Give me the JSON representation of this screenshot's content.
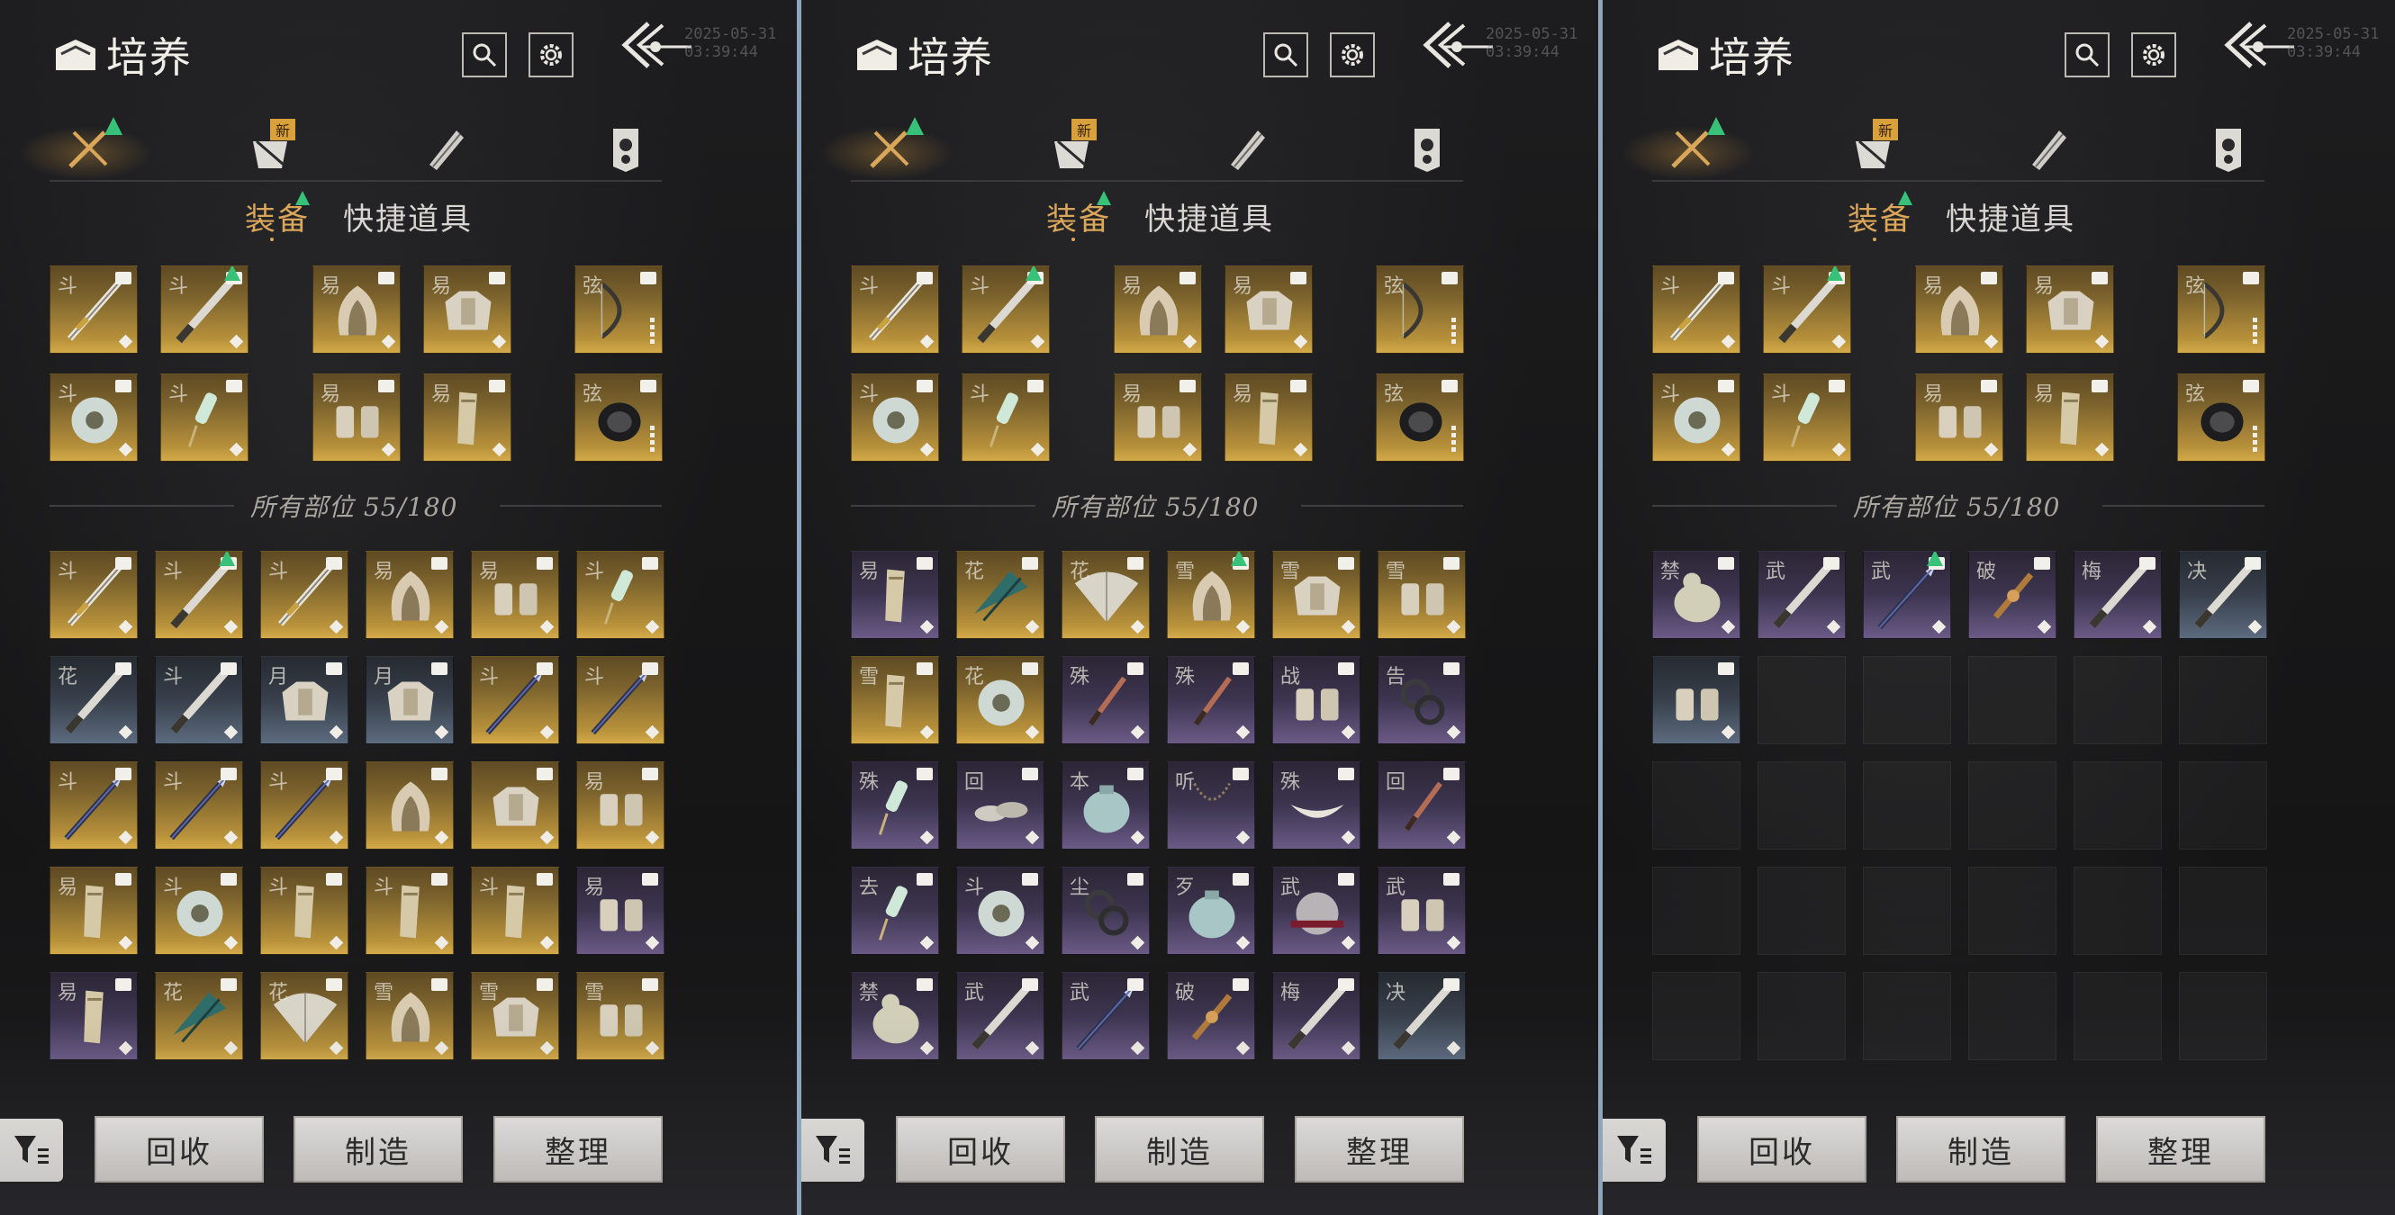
{
  "panels": [
    {
      "header": {
        "title": "培养",
        "timestamp": "2025-05-31 03:39:44"
      },
      "tabs": {
        "equip": "装备",
        "quick": "快捷道具",
        "new_badge": "新"
      },
      "total": "所有部位 55/180",
      "equipped": [
        {
          "char": "斗",
          "q": "gold",
          "art": "sword"
        },
        {
          "char": "斗",
          "q": "gold",
          "art": "blade",
          "up": true
        },
        {
          "char": "易",
          "q": "gold",
          "art": "hood"
        },
        {
          "char": "易",
          "q": "gold",
          "art": "armor"
        },
        {
          "char": "弦",
          "q": "gold",
          "art": "bow",
          "pips": true
        },
        {
          "char": "斗",
          "q": "gold",
          "art": "disc"
        },
        {
          "char": "斗",
          "q": "gold",
          "art": "pendant"
        },
        {
          "char": "易",
          "q": "gold",
          "art": "gloves"
        },
        {
          "char": "易",
          "q": "gold",
          "art": "leg"
        },
        {
          "char": "弦",
          "q": "gold",
          "art": "quiver",
          "pips": true
        }
      ],
      "inventory": [
        {
          "char": "斗",
          "q": "gold",
          "art": "sword"
        },
        {
          "char": "斗",
          "q": "gold",
          "art": "blade",
          "up": true
        },
        {
          "char": "斗",
          "q": "gold",
          "art": "sword"
        },
        {
          "char": "易",
          "q": "gold",
          "art": "hood"
        },
        {
          "char": "易",
          "q": "gold",
          "art": "gloves"
        },
        {
          "char": "斗",
          "q": "gold",
          "art": "pendant"
        },
        {
          "char": "花",
          "q": "blue",
          "art": "blade"
        },
        {
          "char": "斗",
          "q": "blue",
          "art": "blade"
        },
        {
          "char": "月",
          "q": "blue",
          "art": "armor"
        },
        {
          "char": "月",
          "q": "blue",
          "art": "armor"
        },
        {
          "char": "斗",
          "q": "gold",
          "art": "spear"
        },
        {
          "char": "斗",
          "q": "gold",
          "art": "spear"
        },
        {
          "char": "斗",
          "q": "gold",
          "art": "spear"
        },
        {
          "char": "斗",
          "q": "gold",
          "art": "spear"
        },
        {
          "char": "斗",
          "q": "gold",
          "art": "spear"
        },
        {
          "char": "",
          "q": "gold",
          "art": "hood"
        },
        {
          "char": "",
          "q": "gold",
          "art": "armor"
        },
        {
          "char": "易",
          "q": "gold",
          "art": "gloves"
        },
        {
          "char": "易",
          "q": "gold",
          "art": "leg"
        },
        {
          "char": "斗",
          "q": "gold",
          "art": "disc"
        },
        {
          "char": "斗",
          "q": "gold",
          "art": "leg"
        },
        {
          "char": "斗",
          "q": "gold",
          "art": "leg"
        },
        {
          "char": "斗",
          "q": "gold",
          "art": "leg"
        },
        {
          "char": "易",
          "q": "purple",
          "art": "gloves"
        },
        {
          "char": "易",
          "q": "purple",
          "art": "leg"
        },
        {
          "char": "花",
          "q": "gold",
          "art": "umbrella"
        },
        {
          "char": "花",
          "q": "gold",
          "art": "fan"
        },
        {
          "char": "雪",
          "q": "gold",
          "art": "hood"
        },
        {
          "char": "雪",
          "q": "gold",
          "art": "armor"
        },
        {
          "char": "雪",
          "q": "gold",
          "art": "gloves"
        }
      ]
    },
    {
      "header": {
        "title": "培养",
        "timestamp": "2025-05-31 03:39:44"
      },
      "tabs": {
        "equip": "装备",
        "quick": "快捷道具",
        "new_badge": "新"
      },
      "total": "所有部位 55/180",
      "equipped": [
        {
          "char": "斗",
          "q": "gold",
          "art": "sword"
        },
        {
          "char": "斗",
          "q": "gold",
          "art": "blade",
          "up": true
        },
        {
          "char": "易",
          "q": "gold",
          "art": "hood"
        },
        {
          "char": "易",
          "q": "gold",
          "art": "armor"
        },
        {
          "char": "弦",
          "q": "gold",
          "art": "bow",
          "pips": true
        },
        {
          "char": "斗",
          "q": "gold",
          "art": "disc"
        },
        {
          "char": "斗",
          "q": "gold",
          "art": "pendant"
        },
        {
          "char": "易",
          "q": "gold",
          "art": "gloves"
        },
        {
          "char": "易",
          "q": "gold",
          "art": "leg"
        },
        {
          "char": "弦",
          "q": "gold",
          "art": "quiver",
          "pips": true
        }
      ],
      "inventory": [
        {
          "char": "易",
          "q": "purple",
          "art": "leg"
        },
        {
          "char": "花",
          "q": "gold",
          "art": "umbrella"
        },
        {
          "char": "花",
          "q": "gold",
          "art": "fan"
        },
        {
          "char": "雪",
          "q": "gold",
          "art": "hood",
          "up": true
        },
        {
          "char": "雪",
          "q": "gold",
          "art": "armor"
        },
        {
          "char": "雪",
          "q": "gold",
          "art": "gloves"
        },
        {
          "char": "雪",
          "q": "gold",
          "art": "leg"
        },
        {
          "char": "花",
          "q": "gold",
          "art": "disc"
        },
        {
          "char": "殊",
          "q": "purple",
          "art": "dagger"
        },
        {
          "char": "殊",
          "q": "purple",
          "art": "dagger"
        },
        {
          "char": "战",
          "q": "purple",
          "art": "gloves"
        },
        {
          "char": "告",
          "q": "purple",
          "art": "ring"
        },
        {
          "char": "殊",
          "q": "purple",
          "art": "pendant"
        },
        {
          "char": "回",
          "q": "purple",
          "art": "shoes"
        },
        {
          "char": "本",
          "q": "purple",
          "art": "pouch"
        },
        {
          "char": "听",
          "q": "purple",
          "art": "chain"
        },
        {
          "char": "殊",
          "q": "purple",
          "art": "crescent"
        },
        {
          "char": "回",
          "q": "purple",
          "art": "dagger"
        },
        {
          "char": "去",
          "q": "purple",
          "art": "pendant"
        },
        {
          "char": "斗",
          "q": "purple",
          "art": "disc"
        },
        {
          "char": "尘",
          "q": "purple",
          "art": "ring"
        },
        {
          "char": "歹",
          "q": "purple",
          "art": "pouch"
        },
        {
          "char": "武",
          "q": "purple",
          "art": "orb"
        },
        {
          "char": "武",
          "q": "purple",
          "art": "gloves"
        },
        {
          "char": "禁",
          "q": "purple",
          "art": "creature"
        },
        {
          "char": "武",
          "q": "purple",
          "art": "blade"
        },
        {
          "char": "武",
          "q": "purple",
          "art": "spear"
        },
        {
          "char": "破",
          "q": "purple",
          "art": "vajra"
        },
        {
          "char": "梅",
          "q": "purple",
          "art": "blade"
        },
        {
          "char": "决",
          "q": "blue",
          "art": "blade"
        }
      ]
    },
    {
      "header": {
        "title": "培养",
        "timestamp": "2025-05-31 03:39:44"
      },
      "tabs": {
        "equip": "装备",
        "quick": "快捷道具",
        "new_badge": "新"
      },
      "total": "所有部位 55/180",
      "equipped": [
        {
          "char": "斗",
          "q": "gold",
          "art": "sword"
        },
        {
          "char": "斗",
          "q": "gold",
          "art": "blade",
          "up": true
        },
        {
          "char": "易",
          "q": "gold",
          "art": "hood"
        },
        {
          "char": "易",
          "q": "gold",
          "art": "armor"
        },
        {
          "char": "弦",
          "q": "gold",
          "art": "bow",
          "pips": true
        },
        {
          "char": "斗",
          "q": "gold",
          "art": "disc"
        },
        {
          "char": "斗",
          "q": "gold",
          "art": "pendant"
        },
        {
          "char": "易",
          "q": "gold",
          "art": "gloves"
        },
        {
          "char": "易",
          "q": "gold",
          "art": "leg"
        },
        {
          "char": "弦",
          "q": "gold",
          "art": "quiver",
          "pips": true
        }
      ],
      "inventory": [
        {
          "char": "禁",
          "q": "purple",
          "art": "creature"
        },
        {
          "char": "武",
          "q": "purple",
          "art": "blade"
        },
        {
          "char": "武",
          "q": "purple",
          "art": "spear",
          "up": true
        },
        {
          "char": "破",
          "q": "purple",
          "art": "vajra"
        },
        {
          "char": "梅",
          "q": "purple",
          "art": "blade"
        },
        {
          "char": "决",
          "q": "blue",
          "art": "blade"
        },
        {
          "char": "",
          "q": "blue",
          "art": "gloves"
        },
        {
          "q": "empty"
        },
        {
          "q": "empty"
        },
        {
          "q": "empty"
        },
        {
          "q": "empty"
        },
        {
          "q": "empty"
        },
        {
          "q": "empty"
        },
        {
          "q": "empty"
        },
        {
          "q": "empty"
        },
        {
          "q": "empty"
        },
        {
          "q": "empty"
        },
        {
          "q": "empty"
        },
        {
          "q": "empty"
        },
        {
          "q": "empty"
        },
        {
          "q": "empty"
        },
        {
          "q": "empty"
        },
        {
          "q": "empty"
        },
        {
          "q": "empty"
        },
        {
          "q": "empty"
        },
        {
          "q": "empty"
        },
        {
          "q": "empty"
        },
        {
          "q": "empty"
        },
        {
          "q": "empty"
        },
        {
          "q": "empty"
        }
      ]
    }
  ],
  "buttons": {
    "recycle": "回收",
    "craft": "制造",
    "sort": "整理"
  },
  "colors": {
    "accent": "#d9a65a",
    "upgrade": "#38c178",
    "divider": "#8fa4bd"
  }
}
